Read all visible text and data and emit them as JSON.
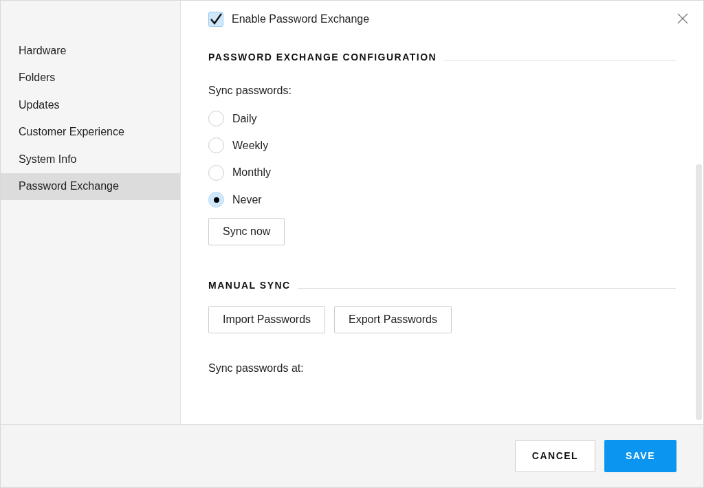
{
  "sidebar": {
    "items": [
      {
        "label": "Hardware",
        "selected": false
      },
      {
        "label": "Folders",
        "selected": false
      },
      {
        "label": "Updates",
        "selected": false
      },
      {
        "label": "Customer Experience",
        "selected": false
      },
      {
        "label": "System Info",
        "selected": false
      },
      {
        "label": "Password Exchange",
        "selected": true
      }
    ]
  },
  "enable": {
    "label": "Enable Password Exchange",
    "checked": true
  },
  "config": {
    "heading": "PASSWORD EXCHANGE CONFIGURATION",
    "sync_label": "Sync passwords:",
    "options": [
      {
        "label": "Daily",
        "selected": false
      },
      {
        "label": "Weekly",
        "selected": false
      },
      {
        "label": "Monthly",
        "selected": false
      },
      {
        "label": "Never",
        "selected": true
      }
    ],
    "sync_button": "Sync now"
  },
  "manual": {
    "heading": "MANUAL SYNC",
    "buttons": [
      "Import Passwords",
      "Export Passwords"
    ],
    "sync_at": "Sync passwords at:"
  },
  "footer": {
    "cancel": "CANCEL",
    "save": "SAVE"
  }
}
